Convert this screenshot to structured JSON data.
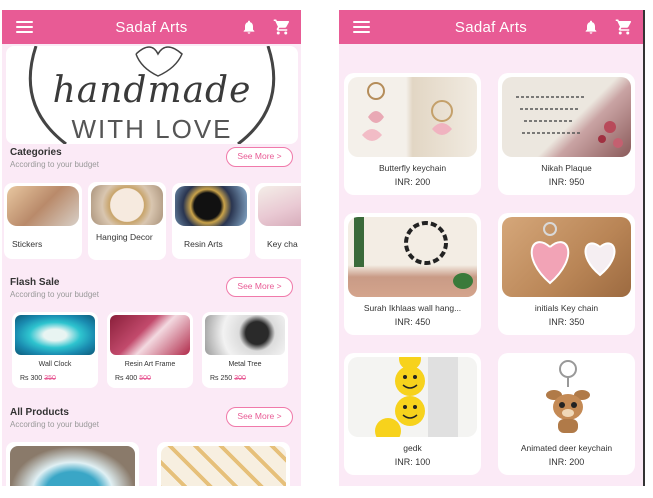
{
  "left": {
    "appbar": {
      "title": "Sadaf Arts"
    },
    "banner": {
      "script": "handmade",
      "sub": "WITH LOVE"
    },
    "categories": {
      "title": "Categories",
      "subtitle": "According to your budget",
      "see_more": "See More >",
      "items": [
        {
          "label": "Stickers"
        },
        {
          "label": "Hanging Decor"
        },
        {
          "label": "Resin Arts"
        },
        {
          "label": "Key cha"
        }
      ]
    },
    "flash_sale": {
      "title": "Flash Sale",
      "subtitle": "According to your budget",
      "see_more": "See More >",
      "items": [
        {
          "name": "Wall Clock",
          "price": "Rs 300",
          "old": "350"
        },
        {
          "name": "Resin Art Frame",
          "price": "Rs 400",
          "old": "500"
        },
        {
          "name": "Metal Tree",
          "price": "Rs 250",
          "old": "300"
        }
      ]
    },
    "all_products": {
      "title": "All Products",
      "subtitle": "According to your budget",
      "see_more": "See More >"
    }
  },
  "right": {
    "appbar": {
      "title": "Sadaf Arts"
    },
    "products": [
      {
        "name": "Butterfly keychain",
        "price": "INR: 200"
      },
      {
        "name": "Nikah Plaque",
        "price": "INR: 950"
      },
      {
        "name": "Surah Ikhlaas wall hang...",
        "price": "INR: 450"
      },
      {
        "name": "initials Key chain",
        "price": "INR: 350"
      },
      {
        "name": "gedk",
        "price": "INR: 100"
      },
      {
        "name": "Animated deer keychain",
        "price": "INR: 200"
      }
    ]
  },
  "colors": {
    "accent": "#e85b95",
    "background": "#fbeaf6",
    "strike": "#e85b95"
  }
}
